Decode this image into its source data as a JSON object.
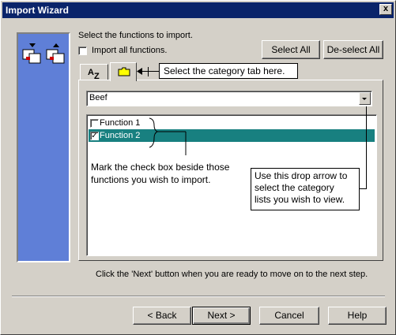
{
  "window": {
    "title": "Import Wizard",
    "close_label": "x"
  },
  "header": {
    "instruction": "Select the functions to import.",
    "import_all_label": "Import all functions.",
    "import_all_checked": false
  },
  "buttons": {
    "select_all": "Select All",
    "deselect_all": "De-select All",
    "back": "< Back",
    "next": "Next >",
    "cancel": "Cancel",
    "help": "Help"
  },
  "tabs": [
    {
      "label": "AZ",
      "icon": "alphabetical-sort-icon"
    },
    {
      "label": "",
      "icon": "folder-icon",
      "active": true
    }
  ],
  "category_select": {
    "value": "Beef"
  },
  "functions": [
    {
      "label": "Function 1",
      "checked": false,
      "selected": false
    },
    {
      "label": "Function 2",
      "checked": true,
      "selected": true
    }
  ],
  "callouts": {
    "tab_hint": "Select the category tab here.",
    "checkbox_hint_line1": "Mark the check box beside those",
    "checkbox_hint_line2": "functions you wish to import.",
    "drop_hint_line1": "Use this drop arrow to",
    "drop_hint_line2": "select the category",
    "drop_hint_line3": "lists you wish to view."
  },
  "footer": {
    "hint": "Click the 'Next' button when you are ready to move on to the next step."
  },
  "colors": {
    "titlebar": "#0a246a",
    "side_panel": "#5f7fd7",
    "selection": "#188080"
  }
}
